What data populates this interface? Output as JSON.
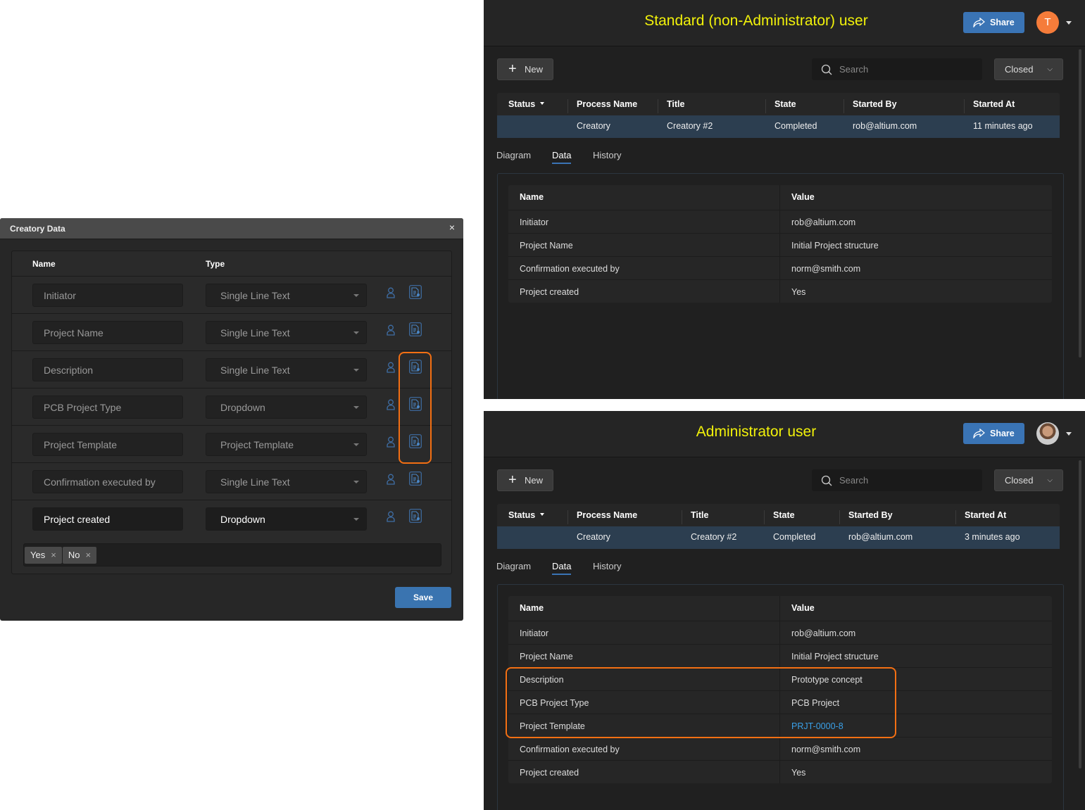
{
  "dialog": {
    "title": "Creatory Data",
    "close": "×",
    "col_name": "Name",
    "col_type": "Type",
    "rows": [
      {
        "name": "Initiator",
        "type": "Single Line Text"
      },
      {
        "name": "Project Name",
        "type": "Single Line Text"
      },
      {
        "name": "Description",
        "type": "Single Line Text"
      },
      {
        "name": "PCB Project Type",
        "type": "Dropdown"
      },
      {
        "name": "Project Template",
        "type": "Project Template"
      },
      {
        "name": "Confirmation executed by",
        "type": "Single Line Text"
      },
      {
        "name": "Project created",
        "type": "Dropdown"
      }
    ],
    "options": [
      "Yes",
      "No"
    ],
    "tag_remove": "×",
    "save": "Save"
  },
  "panels": [
    {
      "title": "Standard (non-Administrator) user",
      "share": "Share",
      "avatar": "T",
      "new": "New",
      "search_placeholder": "Search",
      "filter": "Closed",
      "columns": [
        "Status",
        "Process Name",
        "Title",
        "State",
        "Started By",
        "Started At"
      ],
      "row": [
        "",
        "Creatory",
        "Creatory #2",
        "Completed",
        "rob@altium.com",
        "11 minutes ago"
      ],
      "tabs": [
        "Diagram",
        "Data",
        "History"
      ],
      "active_tab": "Data",
      "data_header": [
        "Name",
        "Value"
      ],
      "data": [
        [
          "Initiator",
          "rob@altium.com"
        ],
        [
          "Project Name",
          "Initial Project structure"
        ],
        [
          "Confirmation executed by",
          "norm@smith.com"
        ],
        [
          "Project created",
          "Yes"
        ]
      ]
    },
    {
      "title": "Administrator user",
      "share": "Share",
      "avatar": "",
      "new": "New",
      "search_placeholder": "Search",
      "filter": "Closed",
      "columns": [
        "Status",
        "Process Name",
        "Title",
        "State",
        "Started By",
        "Started At"
      ],
      "row": [
        "",
        "Creatory",
        "Creatory #2",
        "Completed",
        "rob@altium.com",
        "3 minutes ago"
      ],
      "tabs": [
        "Diagram",
        "Data",
        "History"
      ],
      "active_tab": "Data",
      "data_header": [
        "Name",
        "Value"
      ],
      "data": [
        [
          "Initiator",
          "rob@altium.com"
        ],
        [
          "Project Name",
          "Initial Project structure"
        ],
        [
          "Description",
          "Prototype concept"
        ],
        [
          "PCB Project Type",
          "PCB Project"
        ],
        [
          "Project Template",
          "PRJT-0000-8"
        ],
        [
          "Confirmation executed by",
          "norm@smith.com"
        ],
        [
          "Project created",
          "Yes"
        ]
      ]
    }
  ],
  "colors": {
    "accent": "#3a74b5",
    "highlight": "#f36f13",
    "title": "#f2f20a",
    "link": "#3aa0e8",
    "avatar": "#f57c3a"
  }
}
